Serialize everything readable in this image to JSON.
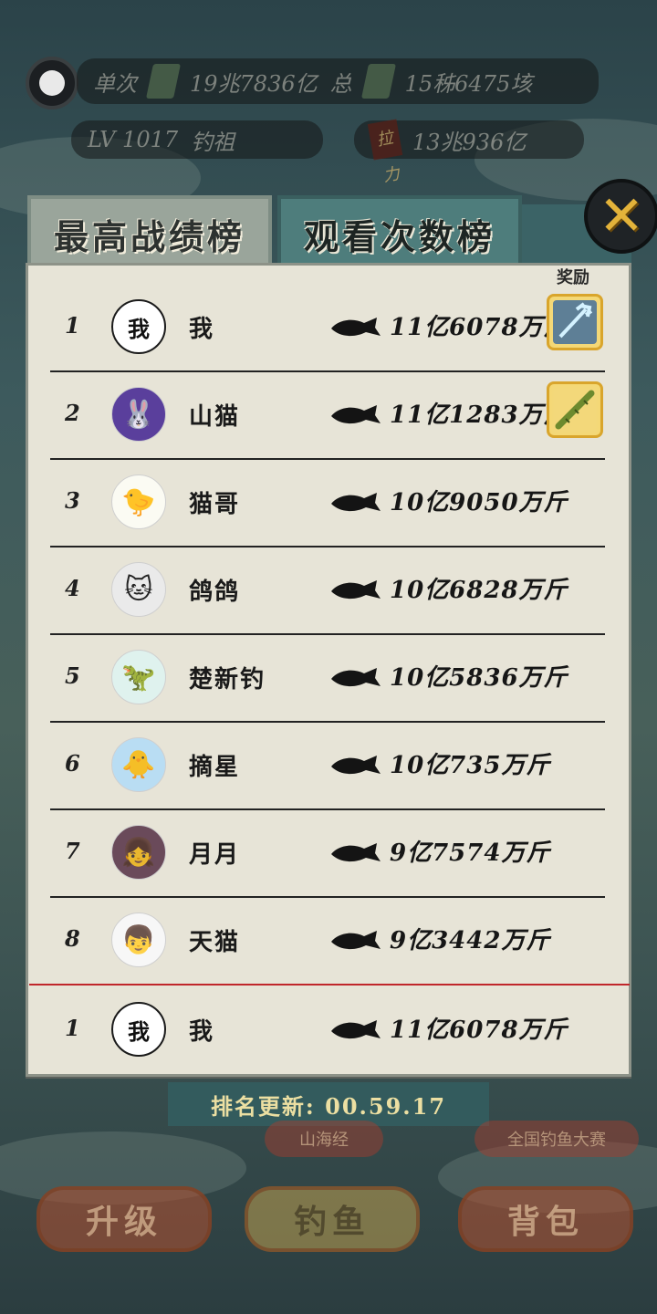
{
  "topbar": {
    "single_label": "单次",
    "single_value": "19兆7836亿",
    "total_label": "总",
    "total_value": "15秭6475垓",
    "level": "LV 1017",
    "title": "钓祖",
    "pull_label": "拉力",
    "pull_value": "13兆936亿"
  },
  "tabs": {
    "best": "最高战绩榜",
    "views": "观看次数榜"
  },
  "reward_header": "奖励",
  "rows": [
    {
      "rank": "1",
      "name": "我",
      "avatar_text": "我",
      "weight": "11亿6078万斤",
      "reward": "trident"
    },
    {
      "rank": "2",
      "name": "山猫",
      "avatar_text": "",
      "weight": "11亿1283万斤",
      "reward": "bamboo-rod"
    },
    {
      "rank": "3",
      "name": "猫哥",
      "avatar_text": "",
      "weight": "10亿9050万斤",
      "reward": ""
    },
    {
      "rank": "4",
      "name": "鸽鸽",
      "avatar_text": "",
      "weight": "10亿6828万斤",
      "reward": ""
    },
    {
      "rank": "5",
      "name": "楚新钓",
      "avatar_text": "",
      "weight": "10亿5836万斤",
      "reward": ""
    },
    {
      "rank": "6",
      "name": "摘星",
      "avatar_text": "",
      "weight": "10亿735万斤",
      "reward": ""
    },
    {
      "rank": "7",
      "name": "月月",
      "avatar_text": "",
      "weight": "9亿7574万斤",
      "reward": ""
    },
    {
      "rank": "8",
      "name": "天猫",
      "avatar_text": "",
      "weight": "9亿3442万斤",
      "reward": ""
    }
  ],
  "my_row": {
    "rank": "1",
    "name": "我",
    "avatar_text": "我",
    "weight": "11亿6078万斤"
  },
  "update": {
    "text": "排名更新: 00.59.17"
  },
  "bottom": {
    "sub_left": "山海经",
    "sub_right": "全国钓鱼大赛",
    "upgrade": "升级",
    "fish": "钓鱼",
    "bag": "背包"
  },
  "colors": {
    "panel": "#e7e4d7",
    "tab_active": "#9aa59b",
    "tab_inactive": "#4e7d7c",
    "close_accent": "#e3b33a",
    "my_divider": "#c0262a",
    "update_bar": "#335b5d"
  }
}
